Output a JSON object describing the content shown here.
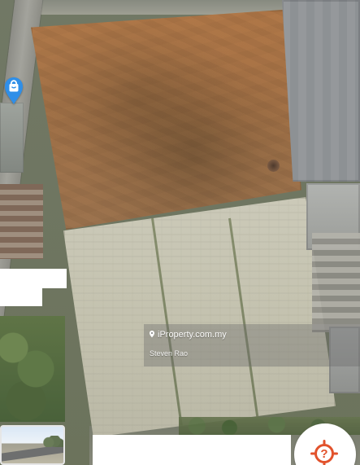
{
  "watermark": {
    "title": "iProperty.com.my",
    "author": "Steven Rao"
  },
  "controls": {
    "help_symbol": "?"
  },
  "icons": {
    "location_marker": "shopping-bag-marker-icon",
    "watermark_pin": "location-pin-icon",
    "help": "help-icon"
  },
  "colors": {
    "marker_blue": "#2f8fe8",
    "help_orange": "#e2522c",
    "watermark_bg": "#696969"
  }
}
